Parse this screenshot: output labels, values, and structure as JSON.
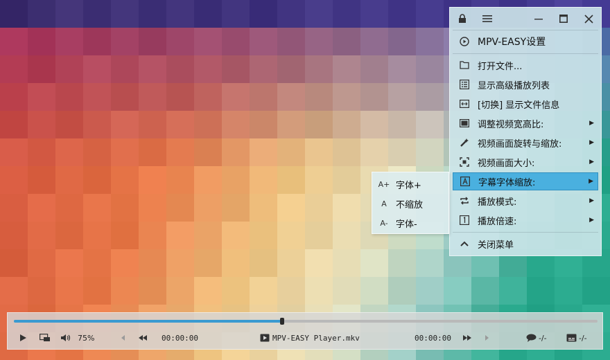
{
  "colors": {
    "highlight": "#4ab0df",
    "progress": "#3a9ad1",
    "panel_bg": "#cde6ea"
  },
  "window_controls": {
    "lock_icon": "lock-icon",
    "menu_icon": "hamburger-icon",
    "minimize_icon": "minimize-icon",
    "maximize_icon": "maximize-icon",
    "close_icon": "close-icon"
  },
  "menu": {
    "header": "MPV-EASY设置",
    "items": [
      {
        "label": "打开文件...",
        "icon": "folder-icon",
        "submenu": false
      },
      {
        "label": "显示高级播放列表",
        "icon": "list-icon",
        "submenu": false
      },
      {
        "label": "[切换] 显示文件信息",
        "icon": "info-toggle-icon",
        "submenu": false
      },
      {
        "label": "调整视频宽高比:",
        "icon": "aspect-icon",
        "submenu": true
      },
      {
        "label": "视频画面旋转与缩放:",
        "icon": "rotate-icon",
        "submenu": true
      },
      {
        "label": "视频画面大小:",
        "icon": "resize-icon",
        "submenu": true
      },
      {
        "label": "字幕字体缩放:",
        "icon": "subtitle-font-icon",
        "submenu": true,
        "highlighted": true
      },
      {
        "label": "播放模式:",
        "icon": "repeat-icon",
        "submenu": true
      },
      {
        "label": "播放倍速:",
        "icon": "speed-icon",
        "submenu": true
      }
    ],
    "close": "关闭菜单"
  },
  "submenu": {
    "items": [
      {
        "icon_text": "A+",
        "label": "字体+"
      },
      {
        "icon_text": "A",
        "label": "不缩放"
      },
      {
        "icon_text": "A-",
        "label": "字体-"
      }
    ]
  },
  "player": {
    "volume": "75%",
    "time_current": "00:00:00",
    "time_total": "00:00:00",
    "filename": "MPV-EASY Player.mkv",
    "subtitle_track": "-/-",
    "audio_track": "-/-",
    "progress_fraction": 0.46
  }
}
